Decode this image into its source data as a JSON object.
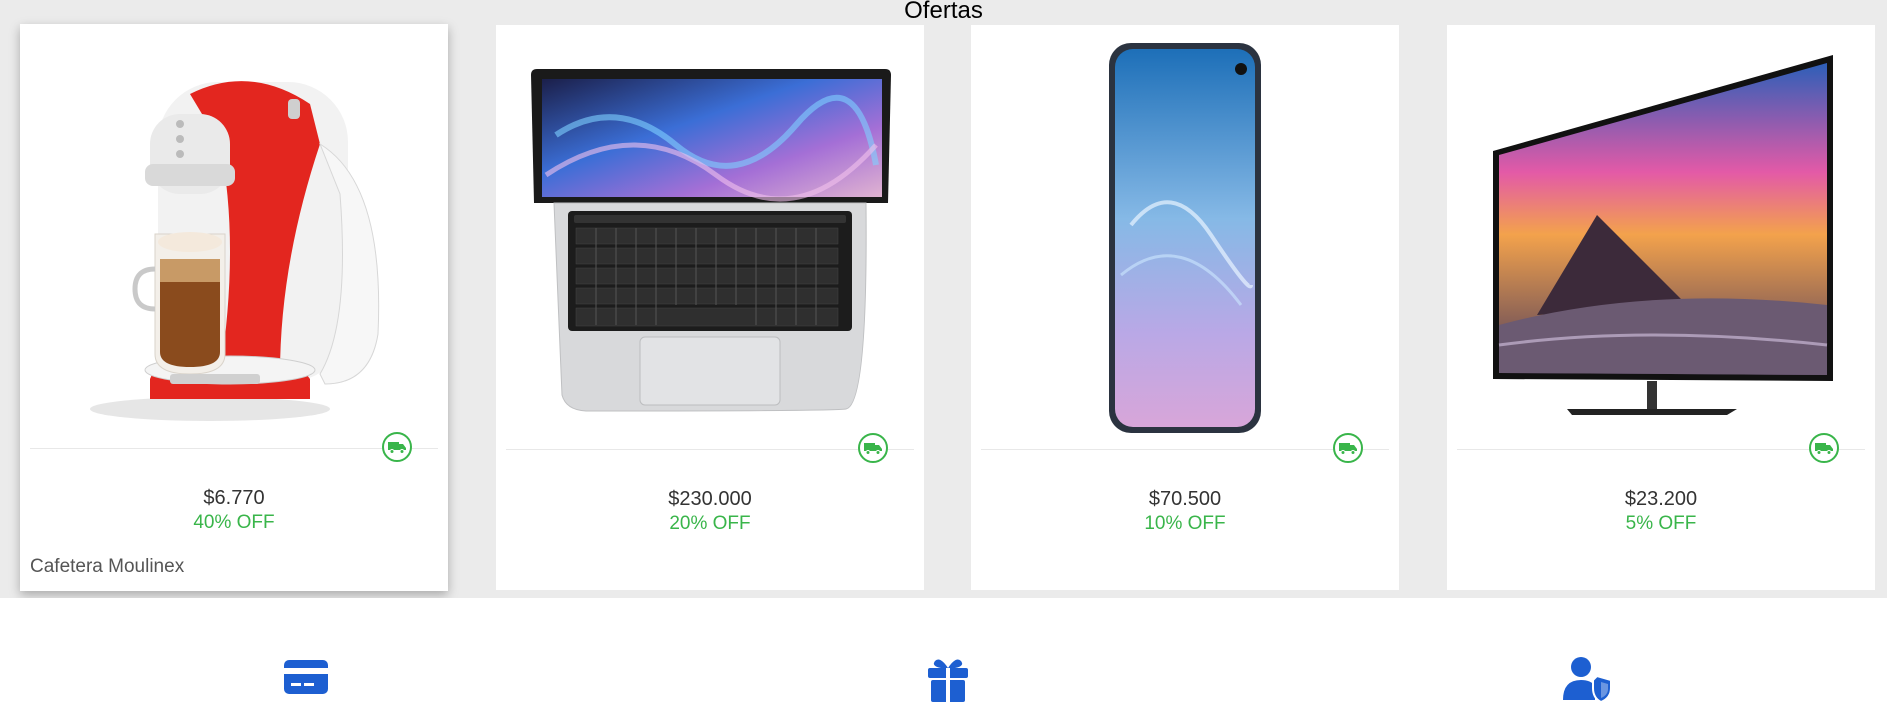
{
  "offers": {
    "title": "Ofertas",
    "products": [
      {
        "name": "Cafetera Moulinex",
        "price": "$6.770",
        "discount": "40% OFF",
        "image_icon": "coffee-machine-image"
      },
      {
        "name": "",
        "price": "$230.000",
        "discount": "20% OFF",
        "image_icon": "laptop-image"
      },
      {
        "name": "",
        "price": "$70.500",
        "discount": "10% OFF",
        "image_icon": "smartphone-image"
      },
      {
        "name": "",
        "price": "$23.200",
        "discount": "5% OFF",
        "image_icon": "television-image"
      }
    ],
    "shipping_icon": "truck-icon",
    "colors": {
      "discount": "#39b54a",
      "background": "#ebebeb",
      "card": "#ffffff"
    }
  },
  "benefits": {
    "icons": [
      "credit-card-icon",
      "gift-icon",
      "user-shield-icon"
    ],
    "color": "#1d5fd1"
  }
}
